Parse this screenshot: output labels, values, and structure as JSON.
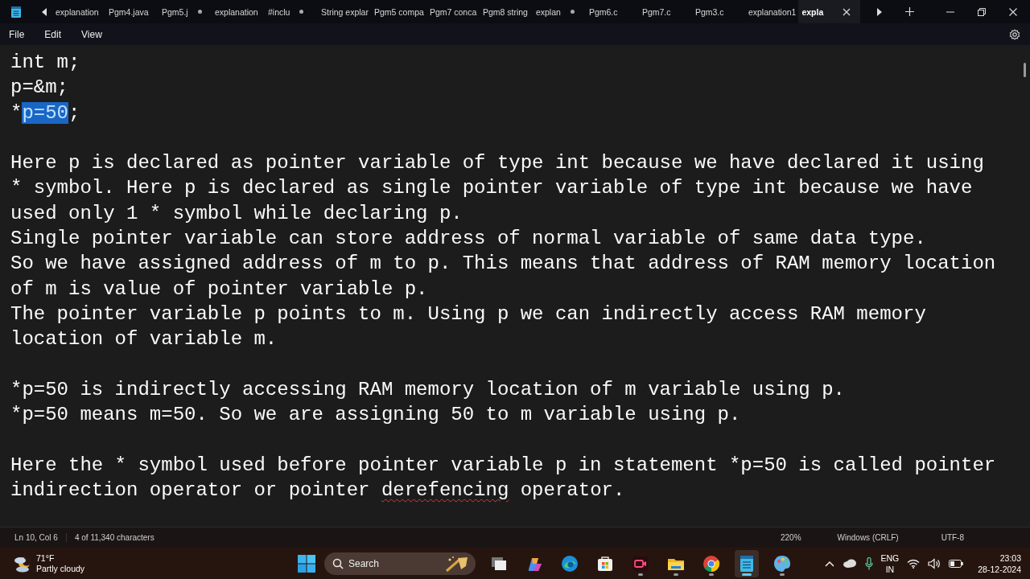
{
  "window": {
    "tabs": [
      {
        "label": "explanation",
        "modified": false,
        "selected": false
      },
      {
        "label": "Pgm4.java",
        "modified": false,
        "selected": false
      },
      {
        "label": "Pgm5.j",
        "modified": true,
        "selected": false
      },
      {
        "label": "explanation",
        "modified": false,
        "selected": false
      },
      {
        "label": "#inclu",
        "modified": true,
        "selected": false
      },
      {
        "label": "String explar",
        "modified": false,
        "selected": false
      },
      {
        "label": "Pgm5 compa",
        "modified": false,
        "selected": false
      },
      {
        "label": "Pgm7 conca",
        "modified": false,
        "selected": false
      },
      {
        "label": "Pgm8 string",
        "modified": false,
        "selected": false
      },
      {
        "label": "explan",
        "modified": true,
        "selected": false
      },
      {
        "label": "Pgm6.c",
        "modified": false,
        "selected": false
      },
      {
        "label": "Pgm7.c",
        "modified": false,
        "selected": false
      },
      {
        "label": "Pgm3.c",
        "modified": false,
        "selected": false
      },
      {
        "label": "explanation1",
        "modified": false,
        "selected": false
      },
      {
        "label": "expla",
        "modified": false,
        "selected": true
      }
    ]
  },
  "menu": [
    "File",
    "Edit",
    "View"
  ],
  "editor": {
    "lines": [
      {
        "parts": [
          {
            "text": "int m;",
            "kind": "plain"
          }
        ]
      },
      {
        "parts": [
          {
            "text": "p=&m;",
            "kind": "plain"
          }
        ]
      },
      {
        "parts": [
          {
            "text": "*",
            "kind": "plain"
          },
          {
            "text": "p=50",
            "kind": "selection"
          },
          {
            "text": ";",
            "kind": "plain"
          }
        ]
      },
      {
        "kind": "blank"
      },
      {
        "parts": [
          {
            "text": "Here p is declared as pointer variable of type int because we have declared it using",
            "kind": "plain"
          }
        ]
      },
      {
        "parts": [
          {
            "text": "* symbol. Here p is declared as single pointer variable of type int because we have",
            "kind": "plain"
          }
        ]
      },
      {
        "parts": [
          {
            "text": "used only 1 * symbol while declaring p.",
            "kind": "plain"
          }
        ]
      },
      {
        "parts": [
          {
            "text": "Single pointer variable can store address of normal variable of same data type.",
            "kind": "plain"
          }
        ]
      },
      {
        "parts": [
          {
            "text": "So we have assigned address of m to p. This means that address of RAM memory location",
            "kind": "plain"
          }
        ]
      },
      {
        "parts": [
          {
            "text": "of m is value of pointer variable p.",
            "kind": "plain"
          }
        ]
      },
      {
        "parts": [
          {
            "text": "The pointer variable p points to m. Using p we can indirectly access RAM memory",
            "kind": "plain"
          }
        ]
      },
      {
        "parts": [
          {
            "text": "location of variable m.",
            "kind": "plain"
          }
        ]
      },
      {
        "kind": "blank"
      },
      {
        "parts": [
          {
            "text": "*p=50 is indirectly accessing RAM memory location of m variable using p.",
            "kind": "plain"
          }
        ]
      },
      {
        "parts": [
          {
            "text": "*p=50 means m=50. So we are assigning 50 to m variable using p.",
            "kind": "plain"
          }
        ]
      },
      {
        "kind": "blank"
      },
      {
        "parts": [
          {
            "text": "Here the * symbol used before pointer variable p in statement *p=50 is called pointer",
            "kind": "plain"
          }
        ]
      },
      {
        "parts": [
          {
            "text": "indirection operator or pointer ",
            "kind": "plain"
          },
          {
            "text": "derefencing",
            "kind": "misspelled"
          },
          {
            "text": " operator.",
            "kind": "plain"
          }
        ]
      }
    ]
  },
  "status_bar": {
    "position": "Ln 10, Col 6",
    "selection": "4 of 11,340 characters",
    "zoom": "220%",
    "line_ending": "Windows (CRLF)",
    "encoding": "UTF-8"
  },
  "taskbar": {
    "weather": {
      "temperature": "71°F",
      "condition": "Partly cloudy"
    },
    "search": {
      "placeholder": "Search"
    },
    "apps": [
      {
        "kind": "task-view",
        "running": false,
        "active": false
      },
      {
        "kind": "copilot",
        "running": false,
        "active": false
      },
      {
        "kind": "edge",
        "running": false,
        "active": false
      },
      {
        "kind": "store",
        "running": false,
        "active": false
      },
      {
        "kind": "recorder",
        "running": true,
        "active": false
      },
      {
        "kind": "folder",
        "running": true,
        "active": false
      },
      {
        "kind": "chrome",
        "running": true,
        "active": false
      },
      {
        "kind": "notepad",
        "running": true,
        "active": true
      },
      {
        "kind": "paint",
        "running": true,
        "active": false
      }
    ],
    "language": [
      "ENG",
      "IN"
    ],
    "time": "23:03",
    "date": "28-12-2024"
  }
}
